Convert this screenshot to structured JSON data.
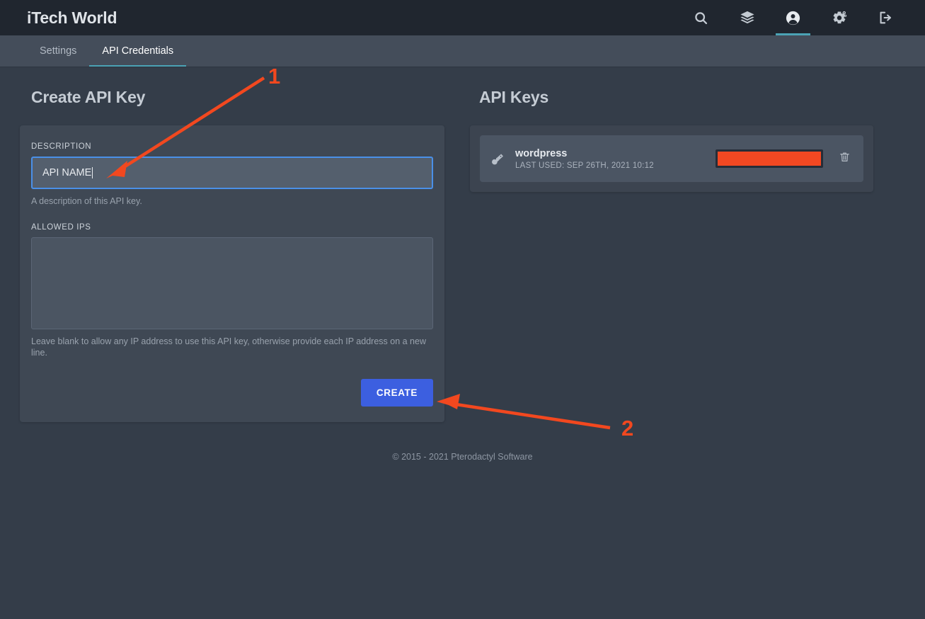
{
  "header": {
    "brand": "iTech World",
    "icons": [
      {
        "name": "search-icon",
        "label": "Search"
      },
      {
        "name": "layers-icon",
        "label": "Servers"
      },
      {
        "name": "account-icon",
        "label": "Account",
        "active": true
      },
      {
        "name": "cogs-icon",
        "label": "Admin"
      },
      {
        "name": "logout-icon",
        "label": "Logout"
      }
    ]
  },
  "tabs": [
    {
      "label": "Settings",
      "active": false
    },
    {
      "label": "API Credentials",
      "active": true
    }
  ],
  "create_form": {
    "title": "Create API Key",
    "description_label": "DESCRIPTION",
    "description_value": "API NAME",
    "description_help": "A description of this API key.",
    "allowed_ips_label": "ALLOWED IPS",
    "allowed_ips_value": "",
    "allowed_ips_help": "Leave blank to allow any IP address to use this API key, otherwise provide each IP address on a new line.",
    "create_label": "CREATE"
  },
  "api_keys": {
    "title": "API Keys",
    "rows": [
      {
        "icon": "key-icon",
        "name": "wordpress",
        "last_used": "LAST USED: SEP 26TH, 2021 10:12",
        "token_redacted": "",
        "delete_icon": "trash-icon"
      }
    ]
  },
  "footer": {
    "copyright": "© 2015 - 2021 Pterodactyl Software"
  },
  "annotations": {
    "step_one": "1",
    "step_two": "2"
  },
  "colors": {
    "header_bg": "#20262f",
    "tabbar_bg": "#444d5a",
    "page_bg": "#343d49",
    "card_bg": "#3f4854",
    "input_bg": "#545f6d",
    "focus_blue": "#4a90e8",
    "accent_teal": "#4ba3b5",
    "button_blue": "#3c5fe0",
    "annotation_orange": "#f2481f",
    "redaction_orange": "#f24822"
  }
}
